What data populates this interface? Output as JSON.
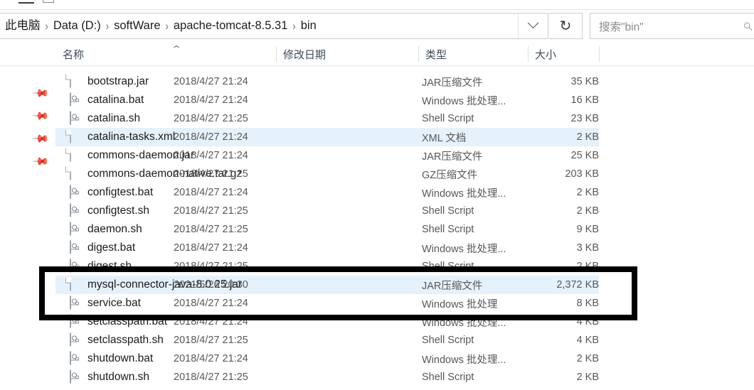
{
  "window": {
    "ribbon_hint": "—"
  },
  "address_bar": {
    "breadcrumbs": [
      "此电脑",
      "Data (D:)",
      "softWare",
      "apache-tomcat-8.5.31",
      "bin"
    ],
    "separator": "›",
    "dropdown_icon": "chevron-down-icon",
    "refresh_icon": "↻",
    "refresh_label": "刷新"
  },
  "search": {
    "placeholder": "搜索\"bin\"",
    "icon": "search-icon"
  },
  "columns": {
    "name": "名称",
    "date": "修改日期",
    "type": "类型",
    "size": "大小",
    "sort_caret": "⌃",
    "sorted_by": "名称",
    "sort_direction": "ascending"
  },
  "nav_pane": {
    "pin_icon": "pin-icon",
    "pin_count": 4
  },
  "annotation": {
    "color": "#000000",
    "shape": "rectangle",
    "border_width": 8
  },
  "files": [
    {
      "name": "bootstrap.jar",
      "date": "2018/4/27 21:24",
      "type": "JAR压缩文件",
      "size": "35 KB",
      "icon": "document-icon",
      "selected": false
    },
    {
      "name": "catalina.bat",
      "date": "2018/4/27 21:24",
      "type": "Windows 批处理...",
      "size": "16 KB",
      "icon": "script-icon",
      "selected": false
    },
    {
      "name": "catalina.sh",
      "date": "2018/4/27 21:25",
      "type": "Shell Script",
      "size": "23 KB",
      "icon": "script-icon",
      "selected": false
    },
    {
      "name": "catalina-tasks.xml",
      "date": "2018/4/27 21:24",
      "type": "XML 文档",
      "size": "2 KB",
      "icon": "document-icon",
      "selected": true
    },
    {
      "name": "commons-daemon.jar",
      "date": "2018/4/27 21:24",
      "type": "JAR压缩文件",
      "size": "25 KB",
      "icon": "document-icon",
      "selected": false
    },
    {
      "name": "commons-daemon-native.tar.gz",
      "date": "2018/4/27 21:25",
      "type": "GZ压缩文件",
      "size": "203 KB",
      "icon": "document-icon",
      "selected": false
    },
    {
      "name": "configtest.bat",
      "date": "2018/4/27 21:24",
      "type": "Windows 批处理...",
      "size": "2 KB",
      "icon": "script-icon",
      "selected": false
    },
    {
      "name": "configtest.sh",
      "date": "2018/4/27 21:25",
      "type": "Shell Script",
      "size": "2 KB",
      "icon": "script-icon",
      "selected": false
    },
    {
      "name": "daemon.sh",
      "date": "2018/4/27 21:25",
      "type": "Shell Script",
      "size": "9 KB",
      "icon": "script-icon",
      "selected": false
    },
    {
      "name": "digest.bat",
      "date": "2018/4/27 21:24",
      "type": "Windows 批处理...",
      "size": "3 KB",
      "icon": "script-icon",
      "selected": false
    },
    {
      "name": "digest.sh",
      "date": "2018/4/27 21:25",
      "type": "Shell Script",
      "size": "2 KB",
      "icon": "script-icon",
      "selected": false
    },
    {
      "name": "mysql-connector-java-8.0.25.jar",
      "date": "2021/5/26 20:30",
      "type": "JAR压缩文件",
      "size": "2,372 KB",
      "icon": "document-icon",
      "selected": true
    },
    {
      "name": "service.bat",
      "date": "2018/4/27 21:24",
      "type": "Windows 批处理",
      "size": "8 KB",
      "icon": "script-icon",
      "selected": false
    },
    {
      "name": "setclasspath.bat",
      "date": "2018/4/27 21:24",
      "type": "Windows 批处理...",
      "size": "4 KB",
      "icon": "script-icon",
      "selected": false
    },
    {
      "name": "setclasspath.sh",
      "date": "2018/4/27 21:25",
      "type": "Shell Script",
      "size": "4 KB",
      "icon": "script-icon",
      "selected": false
    },
    {
      "name": "shutdown.bat",
      "date": "2018/4/27 21:24",
      "type": "Windows 批处理...",
      "size": "2 KB",
      "icon": "script-icon",
      "selected": false
    },
    {
      "name": "shutdown.sh",
      "date": "2018/4/27 21:25",
      "type": "Shell Script",
      "size": "2 KB",
      "icon": "script-icon",
      "selected": false
    }
  ]
}
